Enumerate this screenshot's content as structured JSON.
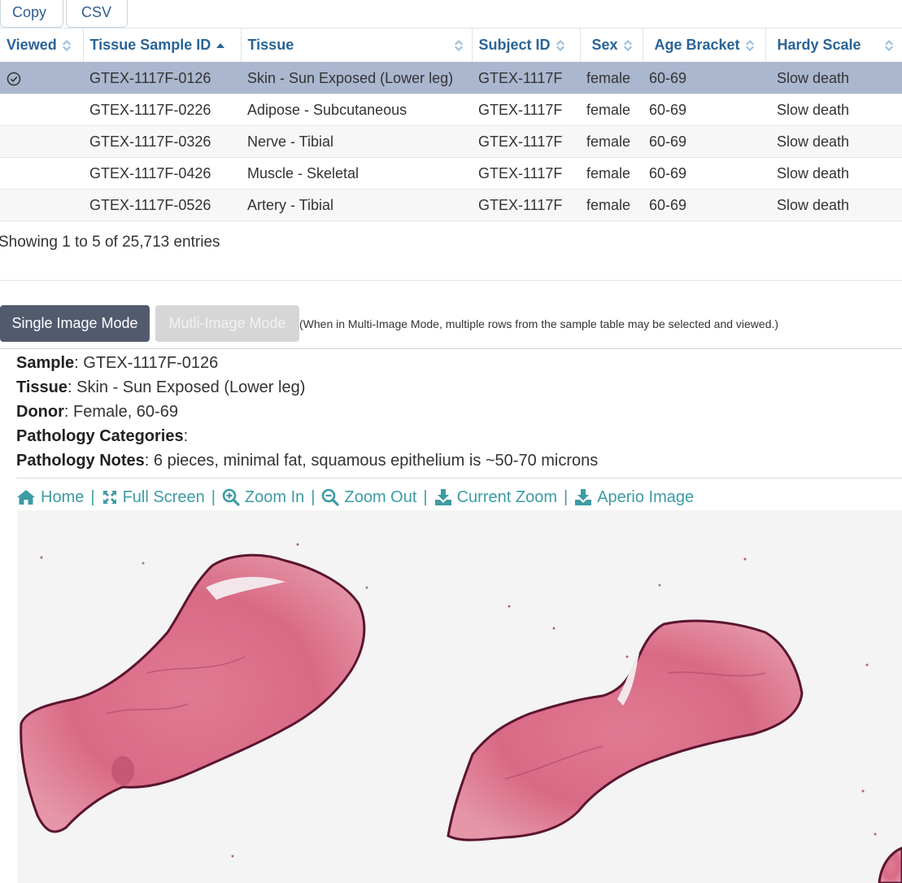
{
  "export": {
    "copy_label": "Copy",
    "csv_label": "CSV"
  },
  "table": {
    "headers": [
      "Viewed",
      "Tissue Sample ID",
      "Tissue",
      "Subject ID",
      "Sex",
      "Age Bracket",
      "Hardy Scale"
    ],
    "sorted_column": "Tissue Sample ID",
    "sort_direction": "ascending",
    "rows": [
      {
        "viewed": true,
        "sample_id": "GTEX-1117F-0126",
        "tissue": "Skin - Sun Exposed (Lower leg)",
        "subject": "GTEX-1117F",
        "sex": "female",
        "age": "60-69",
        "hardy": "Slow death"
      },
      {
        "viewed": false,
        "sample_id": "GTEX-1117F-0226",
        "tissue": "Adipose - Subcutaneous",
        "subject": "GTEX-1117F",
        "sex": "female",
        "age": "60-69",
        "hardy": "Slow death"
      },
      {
        "viewed": false,
        "sample_id": "GTEX-1117F-0326",
        "tissue": "Nerve - Tibial",
        "subject": "GTEX-1117F",
        "sex": "female",
        "age": "60-69",
        "hardy": "Slow death"
      },
      {
        "viewed": false,
        "sample_id": "GTEX-1117F-0426",
        "tissue": "Muscle - Skeletal",
        "subject": "GTEX-1117F",
        "sex": "female",
        "age": "60-69",
        "hardy": "Slow death"
      },
      {
        "viewed": false,
        "sample_id": "GTEX-1117F-0526",
        "tissue": "Artery - Tibial",
        "subject": "GTEX-1117F",
        "sex": "female",
        "age": "60-69",
        "hardy": "Slow death"
      }
    ],
    "info": "Showing 1 to 5 of 25,713 entries"
  },
  "modes": {
    "single_label": "Single Image Mode",
    "multi_label": "Mutli-Image Mode",
    "note": "(When in Multi-Image Mode, multiple rows from the sample table may be selected and viewed.)"
  },
  "details": {
    "sample_label": "Sample",
    "sample_value": ": GTEX-1117F-0126",
    "tissue_label": "Tissue",
    "tissue_value": ": Skin - Sun Exposed (Lower leg)",
    "donor_label": "Donor",
    "donor_value": ": Female, 60-69",
    "pathcat_label": "Pathology Categories",
    "pathcat_value": ":",
    "pathnotes_label": "Pathology Notes",
    "pathnotes_value": ": 6 pieces, minimal fat, squamous epithelium is ~50-70 microns"
  },
  "viewer_links": {
    "home": "Home",
    "full_screen": "Full Screen",
    "zoom_in": "Zoom In",
    "zoom_out": "Zoom Out",
    "current_zoom": "Current Zoom",
    "aperio_image": "Aperio Image",
    "separator": "|"
  },
  "colors": {
    "link": "#2a6496",
    "accent": "#3d9ba3",
    "selected_row": "#aab7cf",
    "active_button": "#525b6e",
    "tissue_pink": "#d9708a",
    "tissue_edge": "#5a1530"
  },
  "icons": [
    "sort-icon",
    "sort-asc-icon",
    "check-circle-icon",
    "home-icon",
    "expand-icon",
    "zoom-in-icon",
    "zoom-out-icon",
    "download-icon"
  ]
}
